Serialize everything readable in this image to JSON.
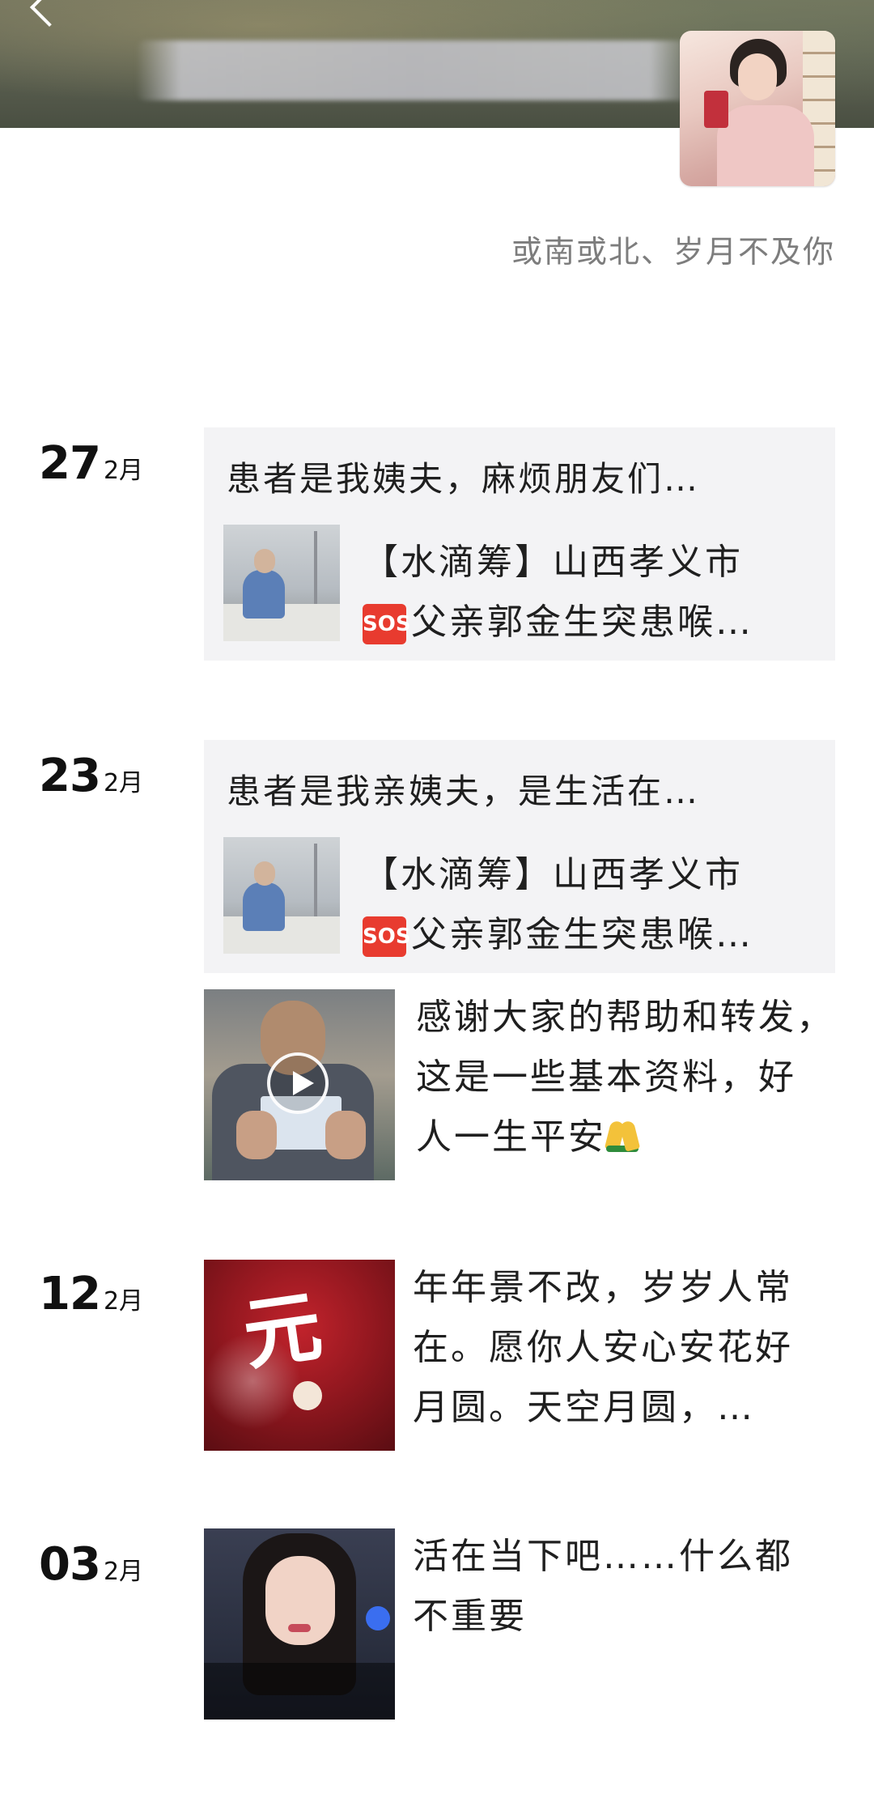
{
  "profile": {
    "signature": "或南或北、岁月不及你"
  },
  "posts": [
    {
      "day": "27",
      "month": "2月",
      "caption": "患者是我姨夫，麻烦朋友们…",
      "share_line1": "【水滴筹】山西孝义市",
      "share_line2": "父亲郭金生突患喉…",
      "share_icon": "SOS"
    },
    {
      "day": "23",
      "month": "2月",
      "caption": "患者是我亲姨夫，是生活在…",
      "share_line1": "【水滴筹】山西孝义市",
      "share_line2": "父亲郭金生突患喉…",
      "share_icon": "SOS",
      "video_text_line1": "感谢大家的帮助和转发，",
      "video_text_line2": "这是一些基本资料，好",
      "video_text_line3": "人一生平安"
    },
    {
      "day": "12",
      "month": "2月",
      "text_line1": "年年景不改，岁岁人常",
      "text_line2": "在。愿你人安心安花好",
      "text_line3": "月圆。天空月圆，…"
    },
    {
      "day": "03",
      "month": "2月",
      "text_line1": "活在当下吧……什么都",
      "text_line2": "不重要"
    }
  ]
}
